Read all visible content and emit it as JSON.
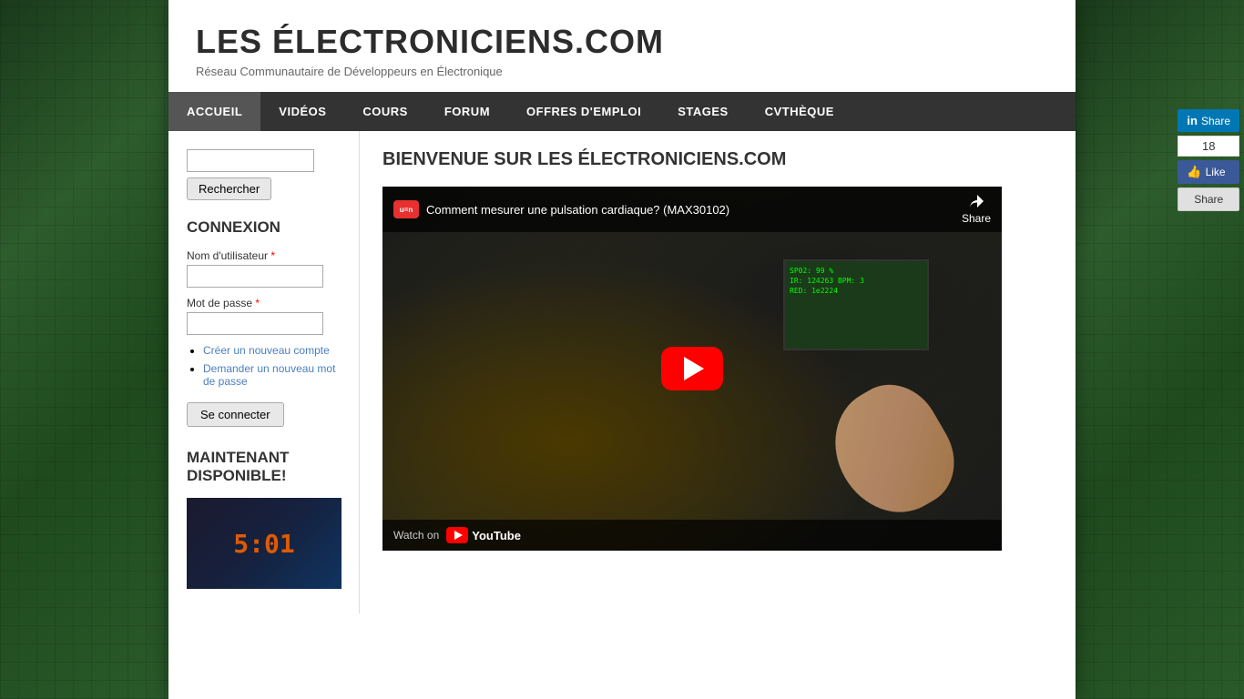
{
  "site": {
    "title": "LES ÉLECTRONICIENS.COM",
    "subtitle": "Réseau Communautaire de Développeurs en Électronique"
  },
  "nav": {
    "items": [
      {
        "label": "ACCUEIL",
        "active": true
      },
      {
        "label": "VIDÉOS",
        "active": false
      },
      {
        "label": "COURS",
        "active": false
      },
      {
        "label": "FORUM",
        "active": false
      },
      {
        "label": "OFFRES D'EMPLOI",
        "active": false
      },
      {
        "label": "STAGES",
        "active": false
      },
      {
        "label": "CVTHÈQUE",
        "active": false
      }
    ]
  },
  "sidebar": {
    "search": {
      "placeholder": "",
      "button_label": "Rechercher"
    },
    "connexion": {
      "title": "CONNEXION",
      "username_label": "Nom d'utilisateur",
      "password_label": "Mot de passe",
      "links": [
        "Créer un nouveau compte",
        "Demander un nouveau mot de passe"
      ],
      "connect_button": "Se connecter"
    },
    "disponible": {
      "title": "MAINTENANT DISPONIBLE!",
      "image_text": "5:01"
    }
  },
  "main": {
    "title": "BIENVENUE SUR LES ÉLECTRONICIENS.COM",
    "video": {
      "channel_logo": "u=n",
      "title": "Comment mesurer une pulsation cardiaque? (MAX30102)",
      "share_label": "Share",
      "watch_on": "Watch on",
      "youtube": "YouTube",
      "display_data": [
        "SP02: 99 %",
        "IR: 124263  BPM: 3",
        "           RED: 1e2224"
      ]
    }
  },
  "share_widget": {
    "linkedin_label": "Share",
    "count": "18",
    "facebook_label": "Like",
    "share_label": "Share"
  },
  "icons": {
    "play": "▶",
    "share": "↗",
    "thumb_up": "👍"
  }
}
